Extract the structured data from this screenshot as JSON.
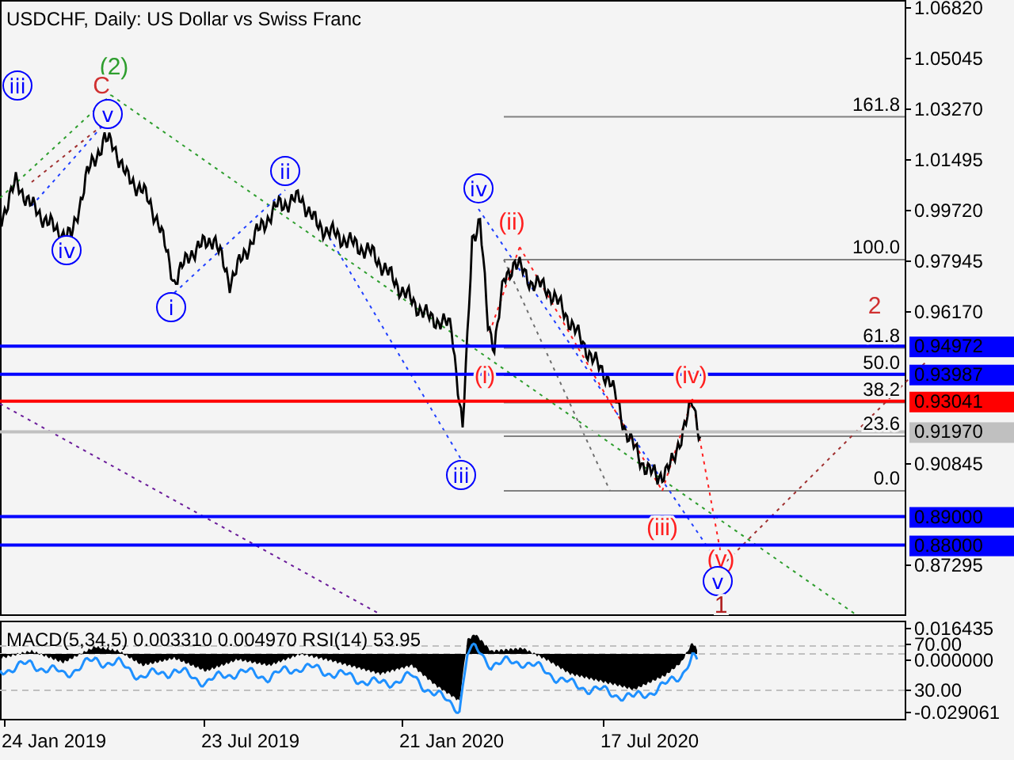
{
  "title": "USDCHF, Daily:  US Dollar vs Swiss Franc",
  "price_axis": {
    "ticks": [
      "1.06820",
      "1.05045",
      "1.03270",
      "1.01495",
      "0.99720",
      "0.97945",
      "0.96170",
      "0.90845",
      "0.87295"
    ]
  },
  "levels": [
    {
      "label": "0.94972",
      "color": "#0000ff"
    },
    {
      "label": "0.93987",
      "color": "#0000ff"
    },
    {
      "label": "0.93041",
      "color": "#ff0000"
    },
    {
      "label": "0.91970",
      "color": "#c0c0c0"
    },
    {
      "label": "0.89000",
      "color": "#0000ff"
    },
    {
      "label": "0.88000",
      "color": "#0000ff"
    }
  ],
  "fibonacci_levels": [
    "161.8",
    "100.0",
    "61.8",
    "50.0",
    "38.2",
    "23.6",
    "0.0"
  ],
  "wave_labels": [
    {
      "text": "(2)",
      "kind": "plain",
      "color": "#2e9e2e"
    },
    {
      "text": "C",
      "kind": "plain",
      "color": "#d03030"
    },
    {
      "text": "iii",
      "kind": "circled",
      "color": "#0000ff"
    },
    {
      "text": "v",
      "kind": "circled",
      "color": "#0000ff"
    },
    {
      "text": "iv",
      "kind": "circled",
      "color": "#0000ff"
    },
    {
      "text": "ii",
      "kind": "circled",
      "color": "#0000ff"
    },
    {
      "text": "i",
      "kind": "circled",
      "color": "#0000ff"
    },
    {
      "text": "iv",
      "kind": "circled",
      "color": "#0000ff"
    },
    {
      "text": "(ii)",
      "kind": "plain",
      "color": "#ff2020"
    },
    {
      "text": "(i)",
      "kind": "plain",
      "color": "#ff2020"
    },
    {
      "text": "iii",
      "kind": "circled",
      "color": "#0000ff"
    },
    {
      "text": "(iv)",
      "kind": "plain",
      "color": "#ff2020"
    },
    {
      "text": "2",
      "kind": "plain",
      "color": "#d03030"
    },
    {
      "text": "(iii)",
      "kind": "plain",
      "color": "#ff2020"
    },
    {
      "text": "(v)",
      "kind": "plain",
      "color": "#ff2020"
    },
    {
      "text": "v",
      "kind": "circled",
      "color": "#0000ff"
    },
    {
      "text": "1",
      "kind": "plain",
      "color": "#b02020"
    }
  ],
  "indicator": {
    "label": "MACD(5,34,5) 0.003310 0.004970 RSI(14) 53.95",
    "ticks": [
      "0.016435",
      "70.00",
      "0.000000",
      "30.00",
      "-0.029061"
    ]
  },
  "date_axis": [
    "24 Jan 2019",
    "23 Jul 2019",
    "21 Jan 2020",
    "17 Jul 2020"
  ]
}
